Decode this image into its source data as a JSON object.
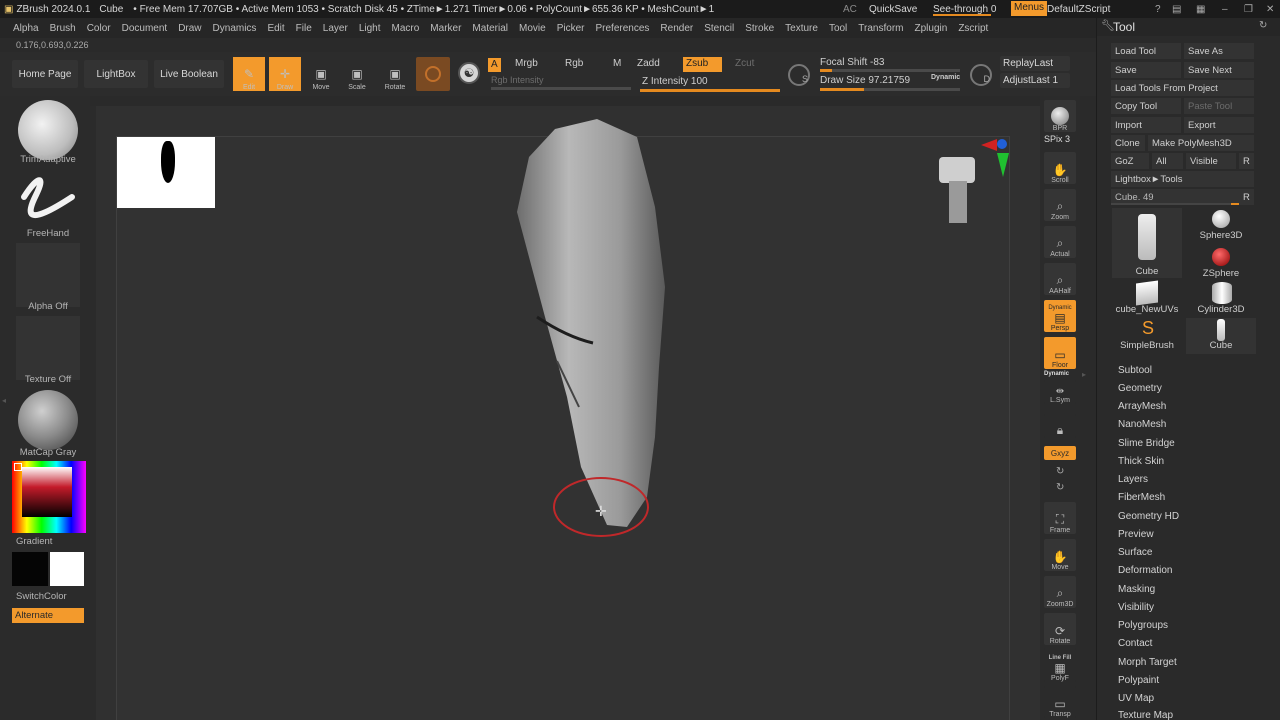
{
  "titlebar": {
    "app": "ZBrush 2024.0.1",
    "tool": "Cube",
    "stats": "• Free Mem 17.707GB • Active Mem 1053 • Scratch Disk 45 • ZTime►1.271 Timer►0.06 • PolyCount►655.36 KP • MeshCount►1",
    "ac": "AC",
    "quicksave": "QuickSave",
    "see_through": "See-through  0",
    "menus": "Menus",
    "script": "DefaultZScript"
  },
  "menubar": [
    "Alpha",
    "Brush",
    "Color",
    "Document",
    "Draw",
    "Dynamics",
    "Edit",
    "File",
    "Layer",
    "Light",
    "Macro",
    "Marker",
    "Material",
    "Movie",
    "Picker",
    "Preferences",
    "Render",
    "Stencil",
    "Stroke",
    "Texture",
    "Tool",
    "Transform",
    "Zplugin",
    "Zscript"
  ],
  "coord_readout": "0.176,0.693,0.226",
  "shelf": {
    "home": "Home Page",
    "lightbox": "LightBox",
    "live_boolean": "Live Boolean",
    "edit": "Edit",
    "draw": "Draw",
    "move": "Move",
    "scale": "Scale",
    "rotate": "Rotate",
    "a": "A",
    "mrgb": "Mrgb",
    "rgb": "Rgb",
    "m": "M",
    "rgb_intensity": "Rgb Intensity",
    "zadd": "Zadd",
    "zsub": "Zsub",
    "zcut": "Zcut",
    "z_intensity": "Z Intensity 100",
    "focal_shift": "Focal Shift -83",
    "draw_size": "Draw Size 97.21759",
    "dynamic": "Dynamic",
    "replay_last": "ReplayLast",
    "adjust_last": "AdjustLast 1",
    "s": "S",
    "d": "D"
  },
  "levels": {
    "z_intensity": 1.0,
    "focal_shift": -83,
    "draw_size": 97.21759
  },
  "left": {
    "brush": "TrimAdaptive",
    "stroke": "FreeHand",
    "alpha": "Alpha Off",
    "texture": "Texture Off",
    "material": "MatCap Gray",
    "gradient": "Gradient",
    "switchcolor": "SwitchColor",
    "alternate": "Alternate"
  },
  "right_strip": {
    "bpr": "BPR",
    "spix": "SPix 3",
    "scroll": "Scroll",
    "zoom": "Zoom",
    "actual": "Actual",
    "aahalf": "AAHalf",
    "dynamic_label": "Dynamic",
    "persp": "Persp",
    "floor": "Floor",
    "dynamic2": "Dynamic",
    "lsym": "L.Sym",
    "xyz": "Gxyz",
    "frame": "Frame",
    "move": "Move",
    "zoom3d": "Zoom3D",
    "rotate": "Rotate",
    "line_fill": "Line Fill",
    "polyf": "PolyF",
    "transp": "Transp"
  },
  "toolpanel": {
    "title": "Tool",
    "buttons": {
      "load_tool": "Load Tool",
      "save_as": "Save As",
      "save": "Save",
      "save_next": "Save Next",
      "load_from_project": "Load Tools From Project",
      "copy_tool": "Copy Tool",
      "paste_tool": "Paste Tool",
      "import": "Import",
      "export": "Export",
      "clone": "Clone",
      "make_polymesh": "Make PolyMesh3D",
      "goz": "GoZ",
      "all": "All",
      "visible": "Visible",
      "r": "R",
      "lightbox_tools": "Lightbox►Tools",
      "cube_slider": "Cube. 49",
      "r2": "R"
    },
    "thumbs": [
      "Cube",
      "Sphere3D",
      "ZSphere",
      "cube_NewUVs",
      "Cylinder3D",
      "SimpleBrush",
      "Cube"
    ],
    "subpalettes": [
      "Subtool",
      "Geometry",
      "ArrayMesh",
      "NanoMesh",
      "Slime Bridge",
      "Thick Skin",
      "Layers",
      "FiberMesh",
      "Geometry HD",
      "Preview",
      "Surface",
      "Deformation",
      "Masking",
      "Visibility",
      "Polygroups",
      "Contact",
      "Morph Target",
      "Polypaint",
      "UV Map",
      "Texture Map"
    ]
  }
}
